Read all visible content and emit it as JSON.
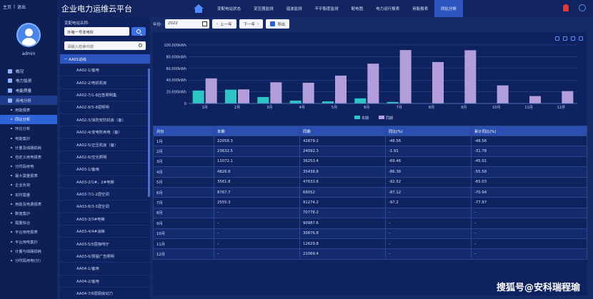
{
  "topbar": {
    "home_link": "主页",
    "separator": "|",
    "exit_link": "退出"
  },
  "user": {
    "name": "admin"
  },
  "sidebar": {
    "menu": [
      {
        "label": "概况",
        "icon": "overview-icon"
      },
      {
        "label": "电力监测",
        "icon": "monitor-icon"
      },
      {
        "label": "电能质量",
        "icon": "quality-icon"
      },
      {
        "label": "用电分析",
        "icon": "analysis-icon",
        "active": true
      }
    ],
    "submenu": [
      {
        "label": "用能报表"
      },
      {
        "label": "同比分析",
        "active": true
      },
      {
        "label": "环比分析"
      },
      {
        "label": "电能集抄"
      },
      {
        "label": "计量及线路损耗"
      },
      {
        "label": "自定义用电报表"
      },
      {
        "label": "分时段用电"
      },
      {
        "label": "最大需量报表"
      },
      {
        "label": "企业负荷"
      },
      {
        "label": "实时需量"
      },
      {
        "label": "用能及电费报表"
      },
      {
        "label": "数值集抄"
      },
      {
        "label": "需量拟合"
      },
      {
        "label": "平台用电报表"
      },
      {
        "label": "平台用电集抄"
      },
      {
        "label": "计量与线路损耗"
      },
      {
        "label": "分时段用电(分)"
      }
    ]
  },
  "header": {
    "title": "企业电力运维云平台",
    "tabs": [
      {
        "label": "变配电站状态"
      },
      {
        "label": "变压器监测"
      },
      {
        "label": "谐波监测"
      },
      {
        "label": "不平衡度监测"
      },
      {
        "label": "配电图"
      },
      {
        "label": "电力运行报表"
      },
      {
        "label": "用能报表"
      },
      {
        "label": "同比分析",
        "active": true
      }
    ]
  },
  "tree_panel": {
    "station_label": "变配电站名称:",
    "station_value": "外墙一号变电所",
    "search_placeholder": "请输入检索内容",
    "parent_node": "AA01进线",
    "nodes": [
      "AA02-1/备用",
      "AA02-2/电机机房",
      "AA02-7/1-8应急照明集",
      "AA02-8/5-8层照明",
      "AA02-3/消防安防机房（备）",
      "AA02-4/变电所用电（备）",
      "AA02-5/正压机房（备）",
      "AA02-6/空光照明",
      "AA03-1/备用",
      "AA03-2/1#、2#电梯",
      "AA03-7/1-2层空调",
      "AA03-8/3-5层空调",
      "AA03-3/3#电梯",
      "AA03-4/4#消梯",
      "AA03-5/5层咖啡厅",
      "AA03-6/预留广告照明",
      "AA04-1/备用",
      "AA04-2/备用",
      "AA04-7/6层厨房动力"
    ]
  },
  "toolbar": {
    "year_label": "年份:",
    "year_value": "2022",
    "prev_label": "上一年",
    "next_label": "下一年",
    "export_label": "导出"
  },
  "chart_data": {
    "type": "bar",
    "categories": [
      "1月",
      "2月",
      "3月",
      "4月",
      "5月",
      "6月",
      "7月",
      "8月",
      "9月",
      "10月",
      "11月",
      "12月"
    ],
    "series": [
      {
        "name": "本期",
        "color": "#2dc6c6",
        "values": [
          22058.3,
          23632.5,
          11072.1,
          4826.8,
          3561.8,
          8767.7,
          2555.3,
          null,
          null,
          null,
          null,
          null
        ]
      },
      {
        "name": "同期",
        "color": "#b39ddb",
        "values": [
          42879.2,
          24092.3,
          36253.4,
          35438.8,
          47633.6,
          68052,
          91274.2,
          70778.2,
          90987.6,
          30876.8,
          12629.8,
          21069.4
        ]
      }
    ],
    "yticks": [
      "0",
      "20,000kWh",
      "40,000kWh",
      "60,000kWh",
      "80,000kWh",
      "100,000kWh"
    ],
    "ylim": [
      0,
      100000
    ]
  },
  "table": {
    "headers": [
      "月份",
      "本期",
      "同期",
      "同比(%)",
      "累计同比(%)"
    ],
    "rows": [
      [
        "1月",
        "22058.3",
        "42879.2",
        "-48.56",
        "-48.56"
      ],
      [
        "2月",
        "23632.5",
        "24092.3",
        "-1.91",
        "-31.78"
      ],
      [
        "3月",
        "11072.1",
        "36253.4",
        "-69.46",
        "-45.01"
      ],
      [
        "4月",
        "4826.8",
        "35438.8",
        "-86.38",
        "-55.58"
      ],
      [
        "5月",
        "3561.8",
        "47633.6",
        "-92.52",
        "-65.03"
      ],
      [
        "6月",
        "8767.7",
        "68052",
        "-87.12",
        "-70.94"
      ],
      [
        "7月",
        "2555.3",
        "91274.2",
        "-97.2",
        "-77.87"
      ],
      [
        "8月",
        "-",
        "70778.2",
        "-",
        "-"
      ],
      [
        "9月",
        "-",
        "90987.6",
        "-",
        "-"
      ],
      [
        "10月",
        "-",
        "30876.8",
        "-",
        "-"
      ],
      [
        "11月",
        "-",
        "12629.8",
        "-",
        "-"
      ],
      [
        "12月",
        "-",
        "21069.4",
        "-",
        "-"
      ]
    ]
  },
  "watermark": "搜狐号@安科瑞程瑜"
}
